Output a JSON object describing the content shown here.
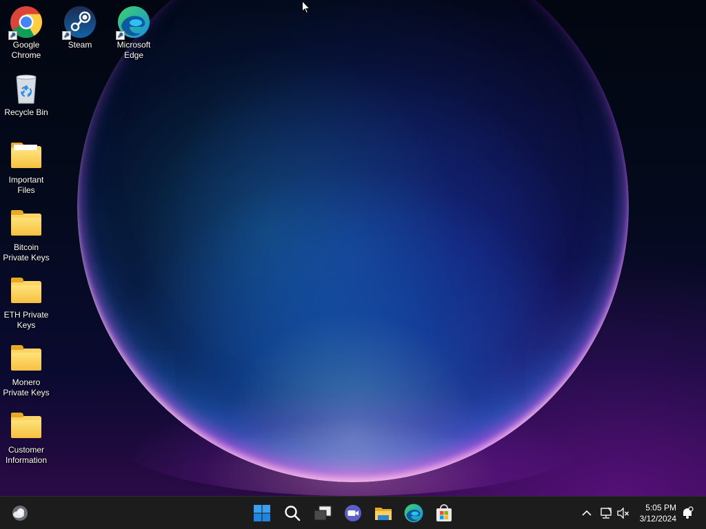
{
  "desktop": {
    "icons": [
      {
        "label": "Google Chrome",
        "icon": "chrome-icon",
        "shortcut": true
      },
      {
        "label": "Steam",
        "icon": "steam-icon",
        "shortcut": true
      },
      {
        "label": "Microsoft Edge",
        "icon": "edge-icon",
        "shortcut": true
      },
      {
        "label": "Recycle Bin",
        "icon": "recycle-bin-icon"
      },
      {
        "label": "Important Files",
        "icon": "folder-icon"
      },
      {
        "label": "Bitcoin Private Keys",
        "icon": "folder-icon"
      },
      {
        "label": "ETH Private Keys",
        "icon": "folder-icon"
      },
      {
        "label": "Monero Private Keys",
        "icon": "folder-icon"
      },
      {
        "label": "Customer Information",
        "icon": "folder-icon"
      }
    ]
  },
  "taskbar": {
    "weather_icon": "weather-cloud-icon",
    "pinned": [
      "start-icon",
      "search-icon",
      "task-view-icon",
      "teams-chat-icon",
      "file-explorer-icon",
      "edge-icon",
      "microsoft-store-icon"
    ],
    "tray": {
      "icons": [
        "chevron-up-icon",
        "network-icon",
        "volume-muted-icon"
      ],
      "time": "5:05 PM",
      "date": "3/12/2024",
      "notification_icon": "notification-bell-icon"
    }
  },
  "colors": {
    "taskbar_bg": "#1c1c1c",
    "folder_yellow": "#f3b933",
    "windows_blue": "#1e90ff"
  }
}
